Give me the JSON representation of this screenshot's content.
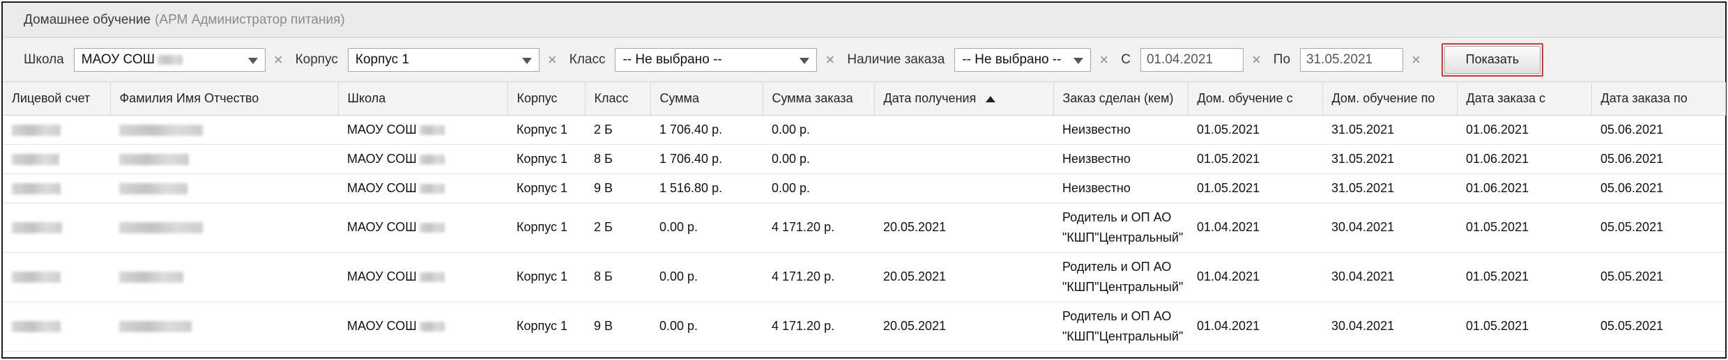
{
  "panel": {
    "title": "Домашнее обучение",
    "subtitle": "(АРМ Администратор питания)"
  },
  "filters": {
    "school_label": "Школа",
    "school_value": "МАОУ СОШ",
    "building_label": "Корпус",
    "building_value": "Корпус 1",
    "class_label": "Класс",
    "class_value": "-- Не выбрано --",
    "order_label": "Наличие заказа",
    "order_value": "-- Не выбрано --",
    "from_label": "С",
    "from_value": "01.04.2021",
    "to_label": "По",
    "to_value": "31.05.2021",
    "clear_glyph": "×",
    "show_button": "Показать"
  },
  "table": {
    "columns": [
      "Лицевой счет",
      "Фамилия Имя Отчество",
      "Школа",
      "Корпус",
      "Класс",
      "Сумма",
      "Сумма заказа",
      "Дата получения",
      "Заказ сделан (кем)",
      "Дом. обучение с",
      "Дом. обучение по",
      "Дата заказа с",
      "Дата заказа по"
    ],
    "sort_column": "Дата получения",
    "rows": [
      {
        "school": "МАОУ СОШ",
        "building": "Корпус 1",
        "class": "2 Б",
        "sum": "1 706.40 р.",
        "order_sum": "0.00 р.",
        "received": "",
        "ordered_by": "Неизвестно",
        "home_from": "01.05.2021",
        "home_to": "31.05.2021",
        "order_from": "01.06.2021",
        "order_to": "05.06.2021"
      },
      {
        "school": "МАОУ СОШ",
        "building": "Корпус 1",
        "class": "8 Б",
        "sum": "1 706.40 р.",
        "order_sum": "0.00 р.",
        "received": "",
        "ordered_by": "Неизвестно",
        "home_from": "01.05.2021",
        "home_to": "31.05.2021",
        "order_from": "01.06.2021",
        "order_to": "05.06.2021"
      },
      {
        "school": "МАОУ СОШ",
        "building": "Корпус 1",
        "class": "9 В",
        "sum": "1 516.80 р.",
        "order_sum": "0.00 р.",
        "received": "",
        "ordered_by": "Неизвестно",
        "home_from": "01.05.2021",
        "home_to": "31.05.2021",
        "order_from": "01.06.2021",
        "order_to": "05.06.2021"
      },
      {
        "school": "МАОУ СОШ",
        "building": "Корпус 1",
        "class": "2 Б",
        "sum": "0.00 р.",
        "order_sum": "4 171.20 р.",
        "received": "20.05.2021",
        "ordered_by": "Родитель и ОП АО \"КШП\"Центральный\"",
        "home_from": "01.04.2021",
        "home_to": "30.04.2021",
        "order_from": "01.05.2021",
        "order_to": "05.05.2021"
      },
      {
        "school": "МАОУ СОШ",
        "building": "Корпус 1",
        "class": "8 Б",
        "sum": "0.00 р.",
        "order_sum": "4 171.20 р.",
        "received": "20.05.2021",
        "ordered_by": "Родитель и ОП АО \"КШП\"Центральный\"",
        "home_from": "01.04.2021",
        "home_to": "30.04.2021",
        "order_from": "01.05.2021",
        "order_to": "05.05.2021"
      },
      {
        "school": "МАОУ СОШ",
        "building": "Корпус 1",
        "class": "9 В",
        "sum": "0.00 р.",
        "order_sum": "4 171.20 р.",
        "received": "20.05.2021",
        "ordered_by": "Родитель и ОП АО \"КШП\"Центральный\"",
        "home_from": "01.04.2021",
        "home_to": "30.04.2021",
        "order_from": "01.05.2021",
        "order_to": "05.05.2021"
      }
    ]
  }
}
